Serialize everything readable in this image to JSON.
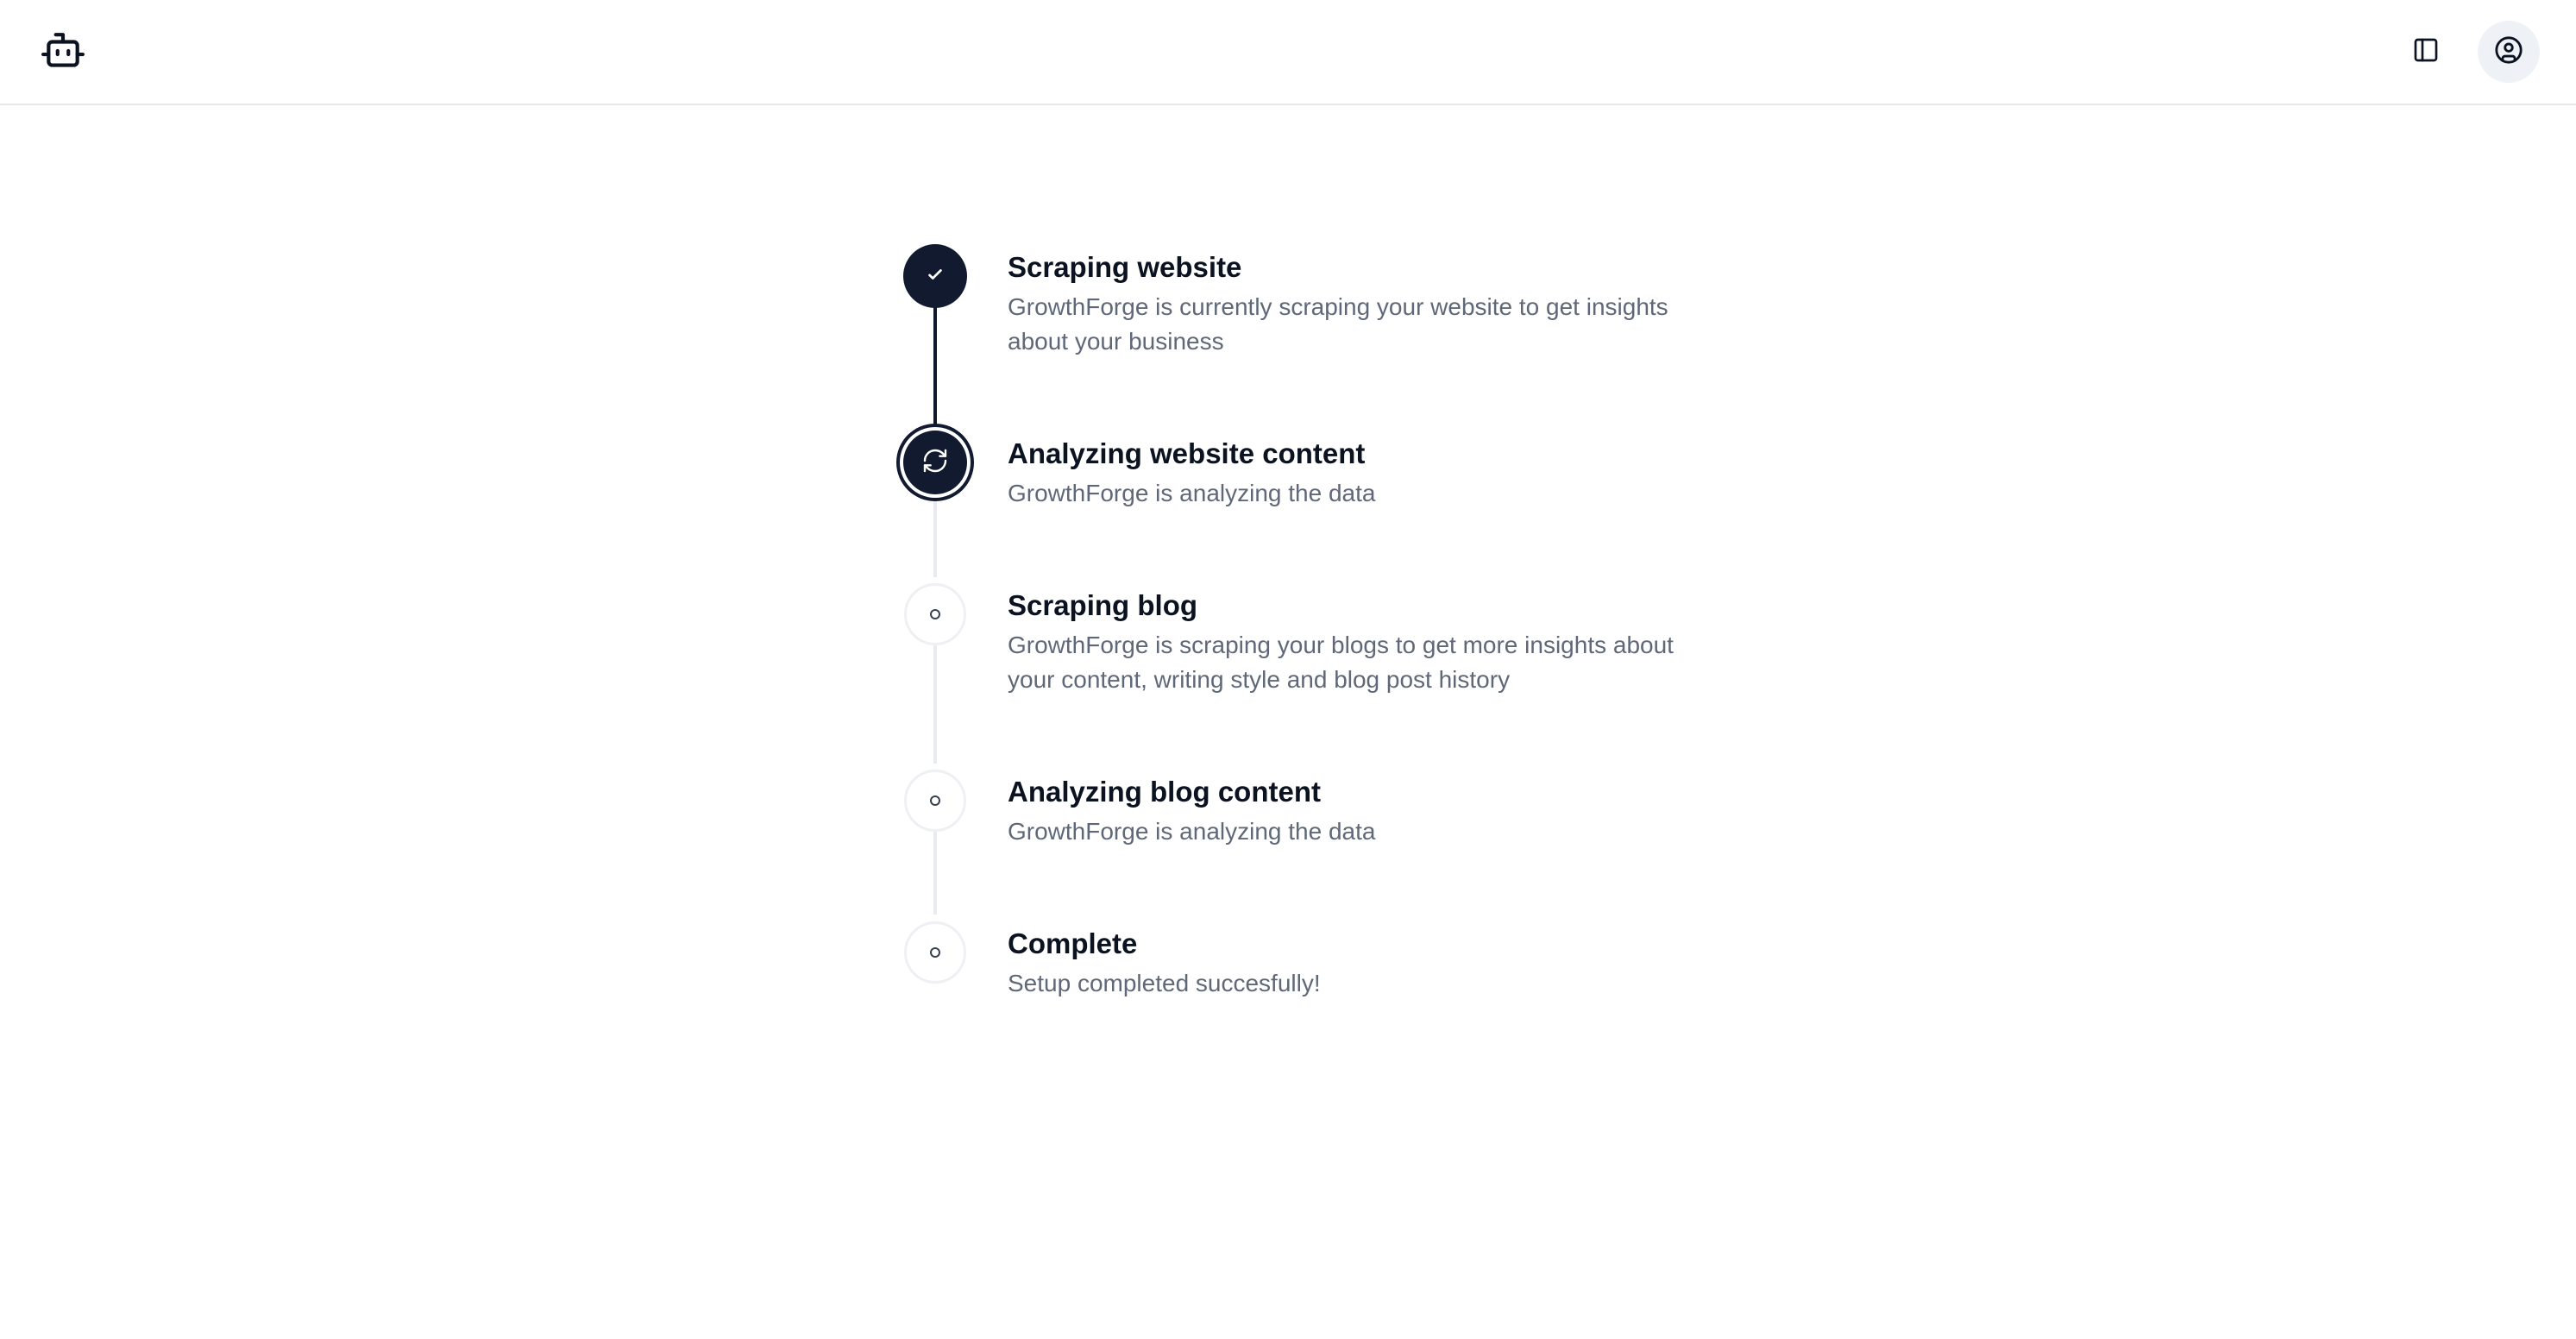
{
  "header": {
    "logo_icon": "robot-icon",
    "sidebar_toggle_icon": "sidebar-panel-icon",
    "account_icon": "user-circle-icon"
  },
  "colors": {
    "accent": "#111a2e",
    "muted_text": "#5f6878",
    "pending_line": "#e8ebef"
  },
  "steps": [
    {
      "title": "Scraping website",
      "description": "GrowthForge is currently scraping your website to get insights about your business",
      "status": "complete",
      "icon": "check-icon"
    },
    {
      "title": "Analyzing website content",
      "description": "GrowthForge is analyzing the data",
      "status": "in-progress",
      "icon": "refresh-icon"
    },
    {
      "title": "Scraping blog",
      "description": "GrowthForge is scraping your blogs to get more insights about your content, writing style and blog post history",
      "status": "pending",
      "icon": "circle-icon"
    },
    {
      "title": "Analyzing blog content",
      "description": "GrowthForge is analyzing the data",
      "status": "pending",
      "icon": "circle-icon"
    },
    {
      "title": "Complete",
      "description": "Setup completed succesfully!",
      "status": "pending",
      "icon": "circle-icon"
    }
  ]
}
